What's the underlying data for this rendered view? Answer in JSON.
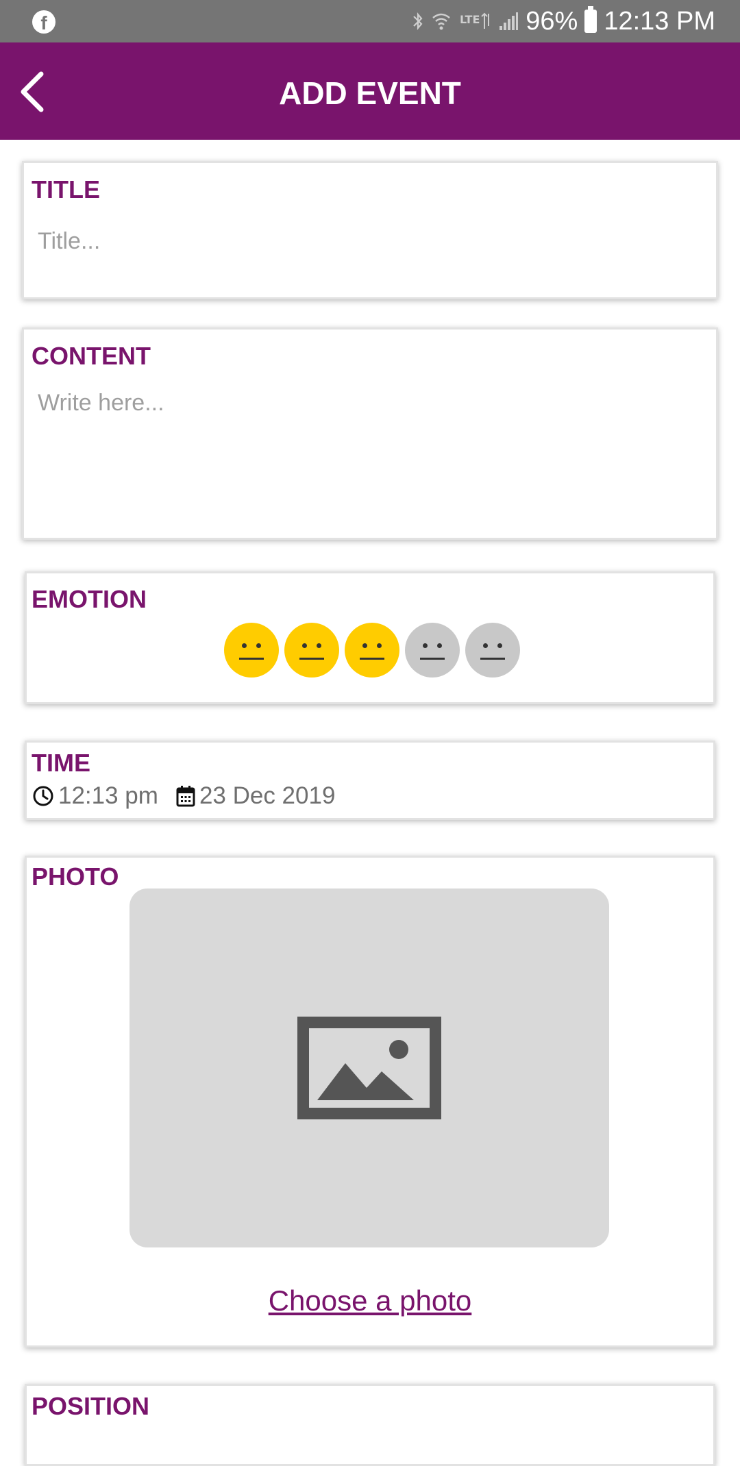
{
  "status_bar": {
    "battery": "96%",
    "time": "12:13 PM",
    "icons": [
      "facebook-icon",
      "bluetooth-icon",
      "wifi-icon",
      "lte-icon",
      "signal-icon",
      "battery-icon"
    ]
  },
  "app_bar": {
    "title": "ADD EVENT",
    "back_icon": "chevron-left-icon"
  },
  "form": {
    "title": {
      "label": "TITLE",
      "placeholder": "Title..."
    },
    "content": {
      "label": "CONTENT",
      "placeholder": "Write here..."
    },
    "emotion": {
      "label": "EMOTION",
      "rating": 3,
      "max": 5
    },
    "time": {
      "label": "TIME",
      "time_value": "12:13 pm",
      "date_value": "23 Dec 2019"
    },
    "photo": {
      "label": "PHOTO",
      "link_text": "Choose a photo"
    },
    "position": {
      "label": "POSITION"
    }
  },
  "colors": {
    "accent": "#79146c",
    "status_bar": "#757575",
    "emotion_active": "#ffcc00",
    "emotion_inactive": "#c8c8c8"
  }
}
